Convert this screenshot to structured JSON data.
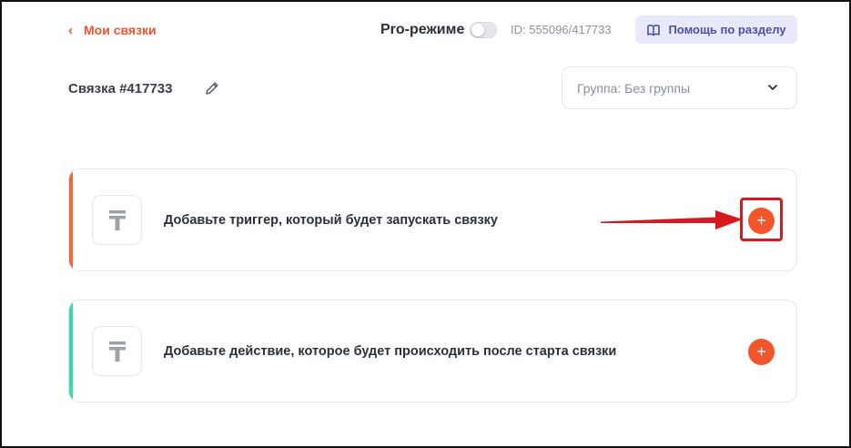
{
  "header": {
    "back_label": "Мои связки",
    "pro_label": "Pro-режиме",
    "id_text": "ID: 555096/417733",
    "help_label": "Помощь по разделу"
  },
  "bundle": {
    "title": "Связка #417733",
    "group_label": "Группа: Без группы"
  },
  "steps": [
    {
      "label": "Добавьте триггер, который будет запускать связку",
      "accent": "#f2663a",
      "add": "+"
    },
    {
      "label": "Добавьте действие, которое будет происходить после старта связки",
      "accent": "#3fd6ad",
      "add": "+"
    }
  ],
  "colors": {
    "accent_orange": "#f2552c",
    "highlight_red": "#d8181e",
    "help_bg": "#e8e9fb"
  }
}
